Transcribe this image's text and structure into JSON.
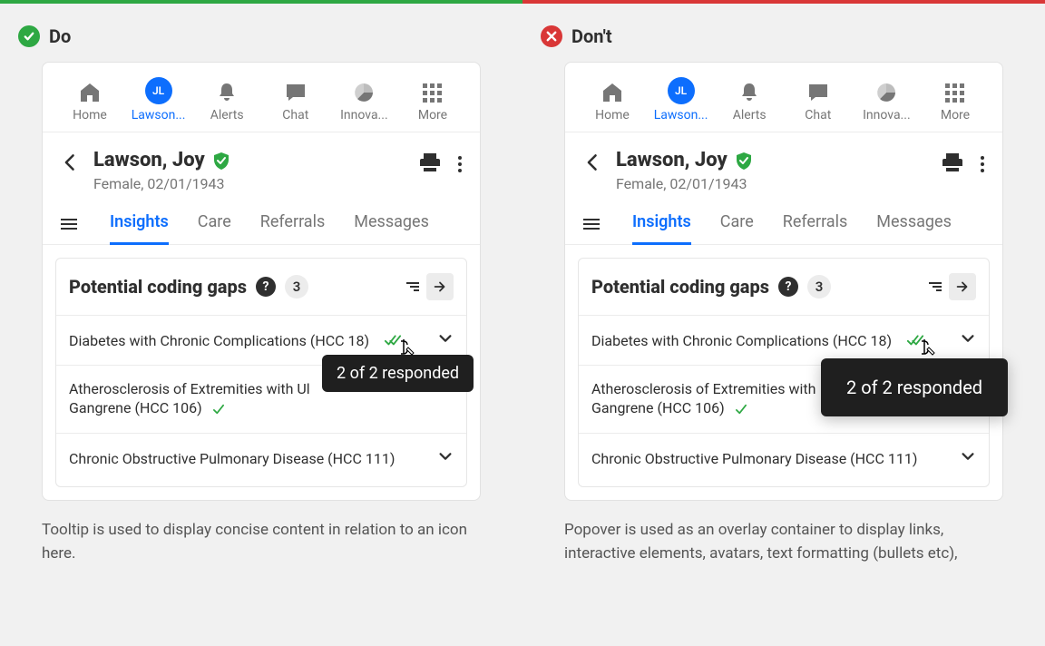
{
  "do": {
    "label": "Do"
  },
  "dont": {
    "label": "Don't"
  },
  "nav": {
    "home": "Home",
    "lawson": "Lawson...",
    "alerts": "Alerts",
    "chat": "Chat",
    "innova": "Innova...",
    "more": "More",
    "avatar_initials": "JL"
  },
  "patient": {
    "name": "Lawson, Joy",
    "sub": "Female, 02/01/1943"
  },
  "tabs": {
    "insights": "Insights",
    "care": "Care",
    "referrals": "Referrals",
    "messages": "Messages"
  },
  "panel": {
    "title": "Potential coding gaps",
    "count": "3",
    "row1": "Diabetes with Chronic Complications (HCC 18)",
    "row2_do": "Atherosclerosis of Extremities with Ul",
    "row2_dont": "Atherosclerosis of Extremities with",
    "row2b": "Gangrene (HCC 106)",
    "row3": "Chronic Obstructive Pulmonary Disease (HCC 111)"
  },
  "tooltip": {
    "text": "2 of 2 responded"
  },
  "popover": {
    "text": "2 of 2 responded"
  },
  "caption": {
    "do": "Tooltip is used to display concise content in relation to an icon here.",
    "dont": "Popover is used as an overlay container to display links, interactive elements, avatars, text formatting (bullets etc),"
  }
}
